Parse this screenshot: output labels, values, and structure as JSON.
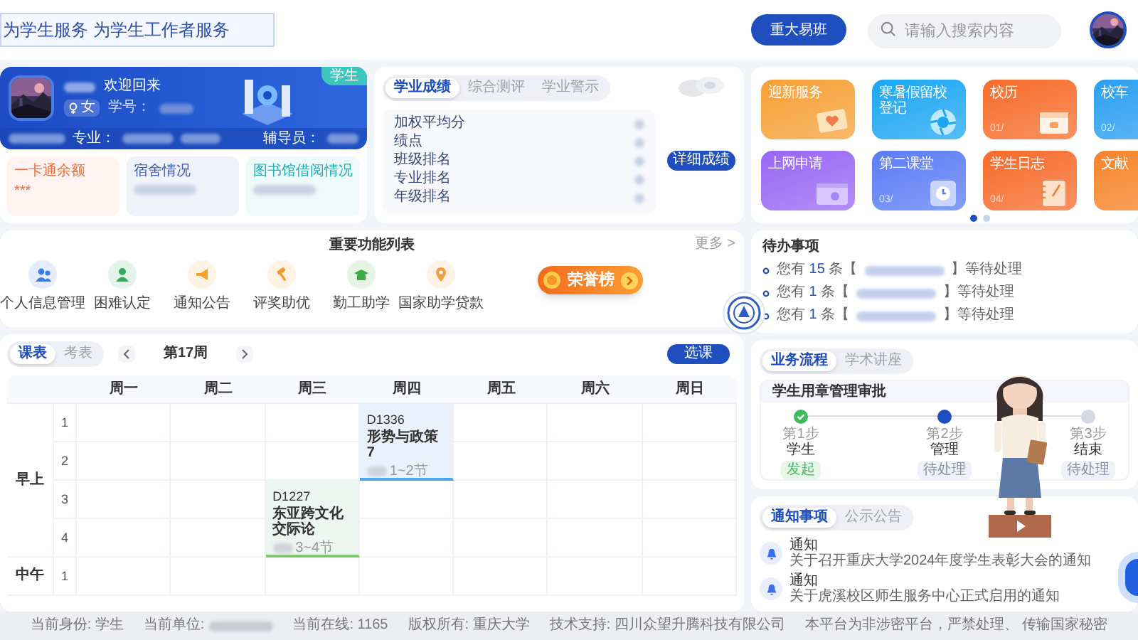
{
  "header": {
    "slogan": "为学生服务 为学生工作者服务",
    "portal_button": "重大易班",
    "search": {
      "placeholder": "请输入搜索内容"
    }
  },
  "welcome": {
    "badge": "学生",
    "greeting": "欢迎回来",
    "gender": "女",
    "student_id_label": "学号：",
    "major_label": "专业：",
    "counselor_label": "辅导员："
  },
  "info_cards": [
    {
      "title": "一卡通余额",
      "value": "***",
      "color": "#f26b3a"
    },
    {
      "title": "宿舍情况",
      "color": "#3b5bb5"
    },
    {
      "title": "图书馆借阅情况",
      "color": "#22aeb4"
    }
  ],
  "academics": {
    "tabs": [
      {
        "label": "学业成绩",
        "selected": true
      },
      {
        "label": "综合测评",
        "selected": false
      },
      {
        "label": "学业警示",
        "selected": false
      }
    ],
    "fields": [
      "加权平均分",
      "绩点",
      "班级排名",
      "专业排名",
      "年级排名"
    ],
    "button": "详细成绩"
  },
  "services": {
    "tiles": [
      {
        "label": "迎新服务",
        "color": "#f6a035"
      },
      {
        "label": "寒暑假留校登记",
        "color": "#1aa6f3"
      },
      {
        "label": "校历",
        "number": "01/",
        "color": "#f76b2a"
      },
      {
        "label": "校车",
        "number": "02/",
        "color": "#2a9ff2"
      },
      {
        "label": "上网申请",
        "color": "#9866f4"
      },
      {
        "label": "第二课堂",
        "number": "03/",
        "color": "#5a7cf6"
      },
      {
        "label": "学生日志",
        "number": "04/",
        "color": "#f76a2a"
      },
      {
        "label": "文献",
        "color": "#f7842a"
      }
    ],
    "pages": [
      {
        "selected": true
      },
      {
        "selected": false
      }
    ]
  },
  "functions": {
    "title": "重要功能列表",
    "more": "更多 >",
    "items": [
      {
        "label": "个人信息管理",
        "color": "#3a7bea"
      },
      {
        "label": "困难认定",
        "color": "#2fae5f"
      },
      {
        "label": "通知公告",
        "color": "#f5a12a"
      },
      {
        "label": "评奖助优",
        "color": "#f59a2a"
      },
      {
        "label": "勤工助学",
        "color": "#3bab3f"
      },
      {
        "label": "国家助学贷款",
        "color": "#f0a040"
      }
    ]
  },
  "honor_badge": "荣誉榜",
  "todo": {
    "title": "待办事项",
    "items": [
      {
        "prefix": "您有",
        "count": "15",
        "unit": "条【",
        "suffix": "】等待处理"
      },
      {
        "prefix": "您有",
        "count": "1",
        "unit": "条【",
        "suffix": "】等待处理"
      },
      {
        "prefix": "您有",
        "count": "1",
        "unit": "条【",
        "suffix": "】等待处理"
      }
    ]
  },
  "schedule": {
    "tabs": [
      {
        "label": "课表",
        "selected": true
      },
      {
        "label": "考表",
        "selected": false
      }
    ],
    "week": "第17周",
    "button": "选课",
    "days": [
      "周一",
      "周二",
      "周三",
      "周四",
      "周五",
      "周六",
      "周日"
    ],
    "sections": [
      {
        "label": "早上",
        "periods": [
          {
            "label": "1",
            "cells": [
              null,
              null,
              null,
              {
                "kind": "double",
                "room": "D1336",
                "name": "形势与政策7",
                "periods": "1~2节",
                "color": "#4aa6ef"
              },
              null,
              null,
              null
            ]
          },
          {
            "label": "2",
            "cells": [
              null,
              null,
              null,
              null,
              null,
              null,
              null
            ]
          },
          {
            "label": "3",
            "cells": [
              null,
              null,
              {
                "kind": "double",
                "room": "D1227",
                "name": "东亚跨文化交际论",
                "periods": "3~4节",
                "color": "#7cc96a"
              },
              null,
              null,
              null,
              null
            ]
          },
          {
            "label": "4",
            "cells": [
              null,
              null,
              null,
              null,
              null,
              null,
              null
            ]
          }
        ]
      },
      {
        "label": "中午",
        "periods": [
          {
            "label": "1",
            "cells": [
              null,
              null,
              null,
              null,
              null,
              null,
              null
            ]
          }
        ]
      }
    ]
  },
  "process": {
    "tabs": [
      {
        "label": "业务流程",
        "selected": true
      },
      {
        "label": "学术讲座",
        "selected": false
      }
    ],
    "title": "学生用章管理审批",
    "steps": [
      {
        "step": "第1步",
        "role": "学生",
        "status": "发起",
        "done": true,
        "current": false
      },
      {
        "step": "第2步",
        "role": "管理",
        "status": "待处理",
        "done": false,
        "current": true
      },
      {
        "step": "第3步",
        "role": "结束",
        "status": "待处理",
        "done": false,
        "current": false
      }
    ]
  },
  "notices": {
    "tabs": [
      {
        "label": "通知事项",
        "selected": true
      },
      {
        "label": "公示公告",
        "selected": false
      }
    ],
    "items": [
      {
        "title": "通知",
        "text": "关于召开重庆大学2024年度学生表彰大会的通知"
      },
      {
        "title": "通知",
        "text": "关于虎溪校区师生服务中心正式启用的通知"
      }
    ]
  },
  "footer": [
    {
      "text": "当前身份: 学生",
      "kind": "plain"
    },
    {
      "text": "当前单位:",
      "kind": "redacted"
    },
    {
      "text": "当前在线: 1165",
      "kind": "plain"
    },
    {
      "text": "版权所有: 重庆大学",
      "kind": "plain"
    },
    {
      "text": "技术支持: 四川众望升腾科技有限公司",
      "kind": "plain"
    },
    {
      "text": "本平台为非涉密平台，严禁处理、 传输国家秘密",
      "kind": "plain"
    }
  ]
}
